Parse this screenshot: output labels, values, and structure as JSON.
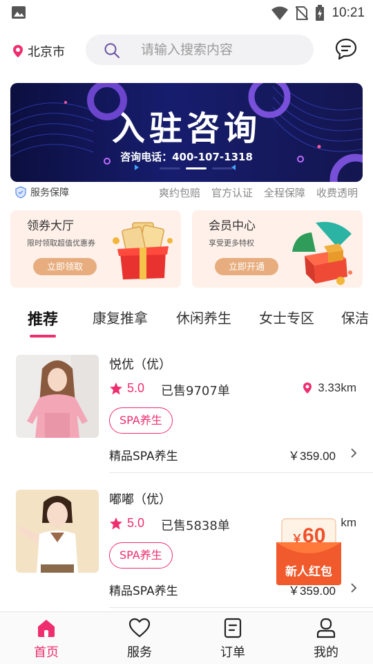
{
  "status_bar": {
    "time": "10:21"
  },
  "header": {
    "location": "北京市",
    "search_placeholder": "请输入搜索内容"
  },
  "banner": {
    "title": "入驻咨询",
    "subtitle": "咨询电话：400-107-1318",
    "slides": 3,
    "active_slide": 1
  },
  "guarantee": {
    "label": "服务保障",
    "items": [
      "爽约包赔",
      "官方认证",
      "全程保障",
      "收费透明"
    ]
  },
  "cards": [
    {
      "title": "领券大厅",
      "subtitle": "限时领取超值优惠券",
      "button": "立即领取"
    },
    {
      "title": "会员中心",
      "subtitle": "享受更多特权",
      "button": "立即开通"
    }
  ],
  "tabs": [
    "推荐",
    "康复推拿",
    "休闲养生",
    "女士专区",
    "保洁"
  ],
  "active_tab": 0,
  "items": [
    {
      "name": "悦优（优）",
      "rating": "5.0",
      "sold": "已售9707单",
      "distance": "3.33km",
      "tag": "SPA养生",
      "desc": "精品SPA养生",
      "price": "￥359.00"
    },
    {
      "name": "嘟嘟（优）",
      "rating": "5.0",
      "sold": "已售5838单",
      "distance": "km",
      "tag": "SPA养生",
      "desc": "精品SPA养生",
      "price": "￥359.00"
    }
  ],
  "hongbao": {
    "amount": "60",
    "currency": "￥",
    "label": "新人红包"
  },
  "bottom_nav": [
    {
      "label": "首页"
    },
    {
      "label": "服务"
    },
    {
      "label": "订单"
    },
    {
      "label": "我的"
    }
  ],
  "colors": {
    "accent": "#ee2e6e",
    "card_bg": "#fff1ea",
    "card_button": "#e7ad7e",
    "banner_bg": "#13164f"
  }
}
